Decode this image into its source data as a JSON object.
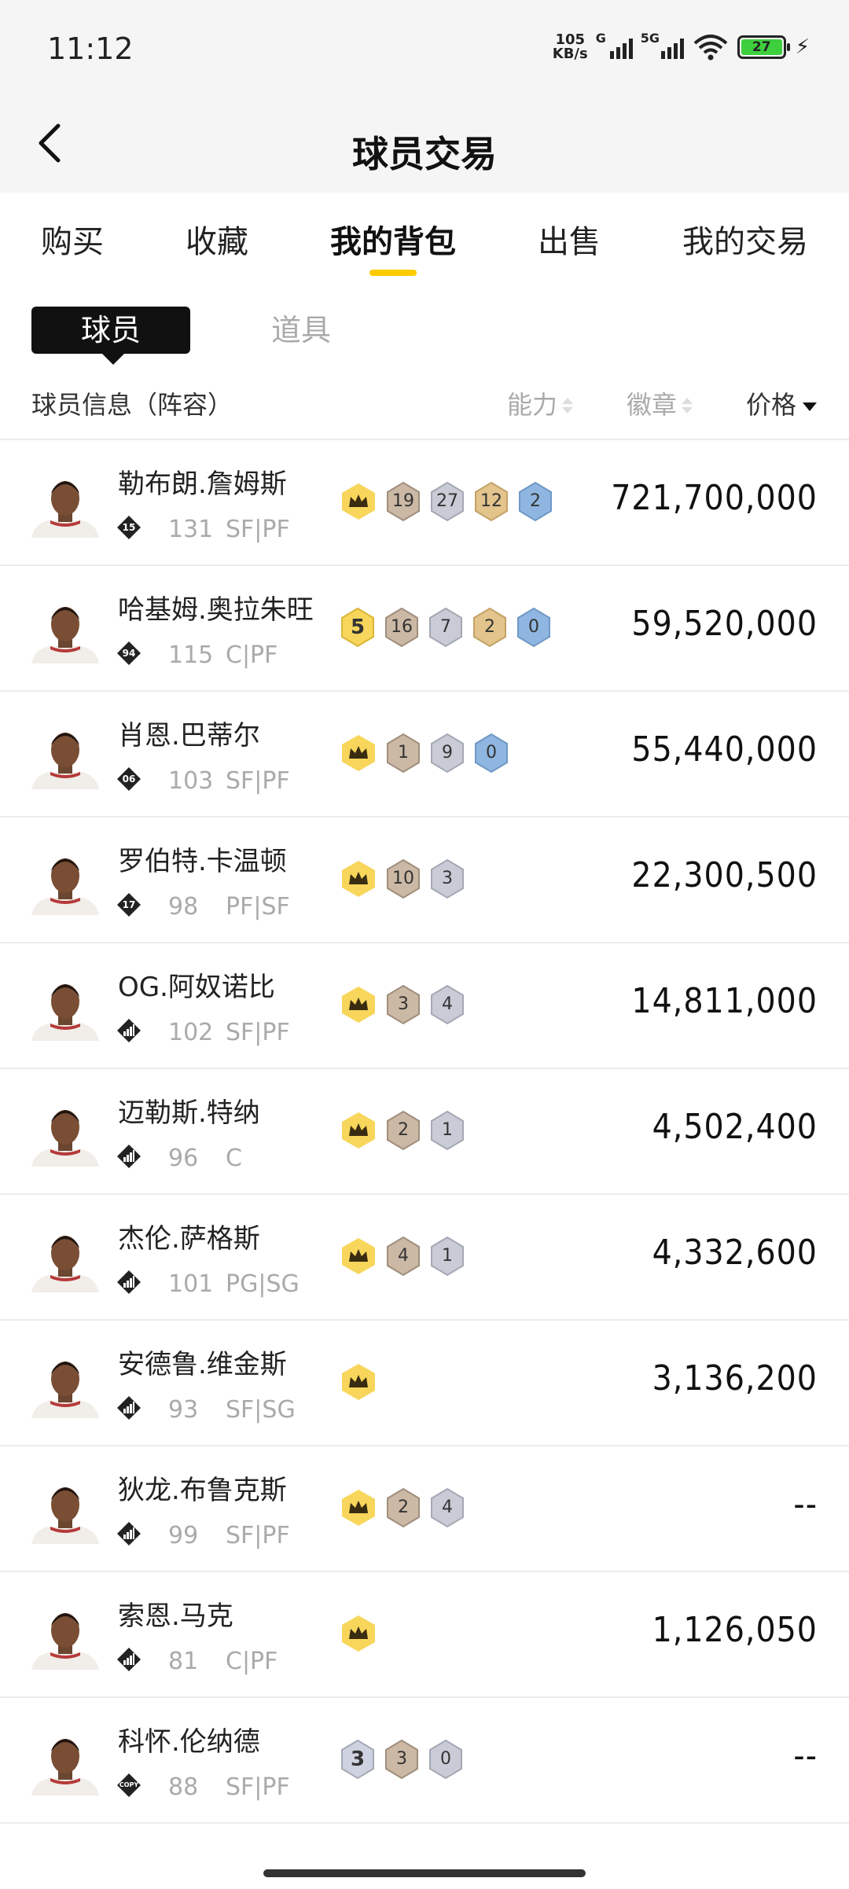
{
  "status_bar": {
    "time": "11:12",
    "net_speed_top": "105",
    "net_speed_bottom": "KB/s",
    "sig1_tag": "G",
    "sig2_tag": "5G",
    "battery": "27"
  },
  "header": {
    "title": "球员交易"
  },
  "tabs": [
    {
      "label": "购买"
    },
    {
      "label": "收藏"
    },
    {
      "label": "我的背包"
    },
    {
      "label": "出售"
    },
    {
      "label": "我的交易"
    }
  ],
  "segments": {
    "active": "球员",
    "inactive": "道具"
  },
  "columns": {
    "info": "球员信息（阵容）",
    "ability": "能力",
    "badges": "徽章",
    "price": "价格"
  },
  "players": [
    {
      "name": "勒布朗.詹姆斯",
      "tier": "15",
      "ovr": "131",
      "pos": "SF|PF",
      "price": "721,700,000",
      "badges": [
        {
          "type": "crown"
        },
        {
          "type": "bronze",
          "v": "19"
        },
        {
          "type": "silver",
          "v": "27"
        },
        {
          "type": "gold",
          "v": "12"
        },
        {
          "type": "blue",
          "v": "2"
        }
      ]
    },
    {
      "name": "哈基姆.奥拉朱旺",
      "tier": "94",
      "ovr": "115",
      "pos": "C|PF",
      "price": "59,520,000",
      "badges": [
        {
          "type": "yellow",
          "v": "5"
        },
        {
          "type": "bronze",
          "v": "16"
        },
        {
          "type": "silver",
          "v": "7"
        },
        {
          "type": "gold",
          "v": "2"
        },
        {
          "type": "blue",
          "v": "0"
        }
      ]
    },
    {
      "name": "肖恩.巴蒂尔",
      "tier": "06",
      "ovr": "103",
      "pos": "SF|PF",
      "price": "55,440,000",
      "badges": [
        {
          "type": "crown"
        },
        {
          "type": "bronze",
          "v": "1"
        },
        {
          "type": "silver",
          "v": "9"
        },
        {
          "type": "blue",
          "v": "0"
        }
      ]
    },
    {
      "name": "罗伯特.卡温顿",
      "tier": "17",
      "ovr": "98",
      "pos": "PF|SF",
      "price": "22,300,500",
      "badges": [
        {
          "type": "crown"
        },
        {
          "type": "bronze",
          "v": "10"
        },
        {
          "type": "silver",
          "v": "3"
        }
      ]
    },
    {
      "name": "OG.阿奴诺比",
      "tier": "bars",
      "ovr": "102",
      "pos": "SF|PF",
      "price": "14,811,000",
      "badges": [
        {
          "type": "crown"
        },
        {
          "type": "bronze",
          "v": "3"
        },
        {
          "type": "silver",
          "v": "4"
        }
      ]
    },
    {
      "name": "迈勒斯.特纳",
      "tier": "bars",
      "ovr": "96",
      "pos": "C",
      "price": "4,502,400",
      "badges": [
        {
          "type": "crown"
        },
        {
          "type": "bronze",
          "v": "2"
        },
        {
          "type": "silver",
          "v": "1"
        }
      ]
    },
    {
      "name": "杰伦.萨格斯",
      "tier": "bars",
      "ovr": "101",
      "pos": "PG|SG",
      "price": "4,332,600",
      "badges": [
        {
          "type": "crown"
        },
        {
          "type": "bronze",
          "v": "4"
        },
        {
          "type": "silver",
          "v": "1"
        }
      ]
    },
    {
      "name": "安德鲁.维金斯",
      "tier": "bars",
      "ovr": "93",
      "pos": "SF|SG",
      "price": "3,136,200",
      "badges": [
        {
          "type": "crown"
        }
      ]
    },
    {
      "name": "狄龙.布鲁克斯",
      "tier": "bars",
      "ovr": "99",
      "pos": "SF|PF",
      "price": "--",
      "badges": [
        {
          "type": "crown"
        },
        {
          "type": "bronze",
          "v": "2"
        },
        {
          "type": "silver",
          "v": "4"
        }
      ]
    },
    {
      "name": "索恩.马克",
      "tier": "bars",
      "ovr": "81",
      "pos": "C|PF",
      "price": "1,126,050",
      "badges": [
        {
          "type": "crown"
        }
      ]
    },
    {
      "name": "科怀.伦纳德",
      "tier": "COPY",
      "ovr": "88",
      "pos": "SF|PF",
      "price": "--",
      "badges": [
        {
          "type": "silver-big",
          "v": "3"
        },
        {
          "type": "bronze",
          "v": "3"
        },
        {
          "type": "silver",
          "v": "0"
        }
      ]
    }
  ],
  "colors": {
    "accent_yellow": "#ffcc00",
    "bronze": "#cbb9a6",
    "silver": "#c9ccd6",
    "gold": "#e2c48c",
    "blue": "#8fb6e0"
  }
}
